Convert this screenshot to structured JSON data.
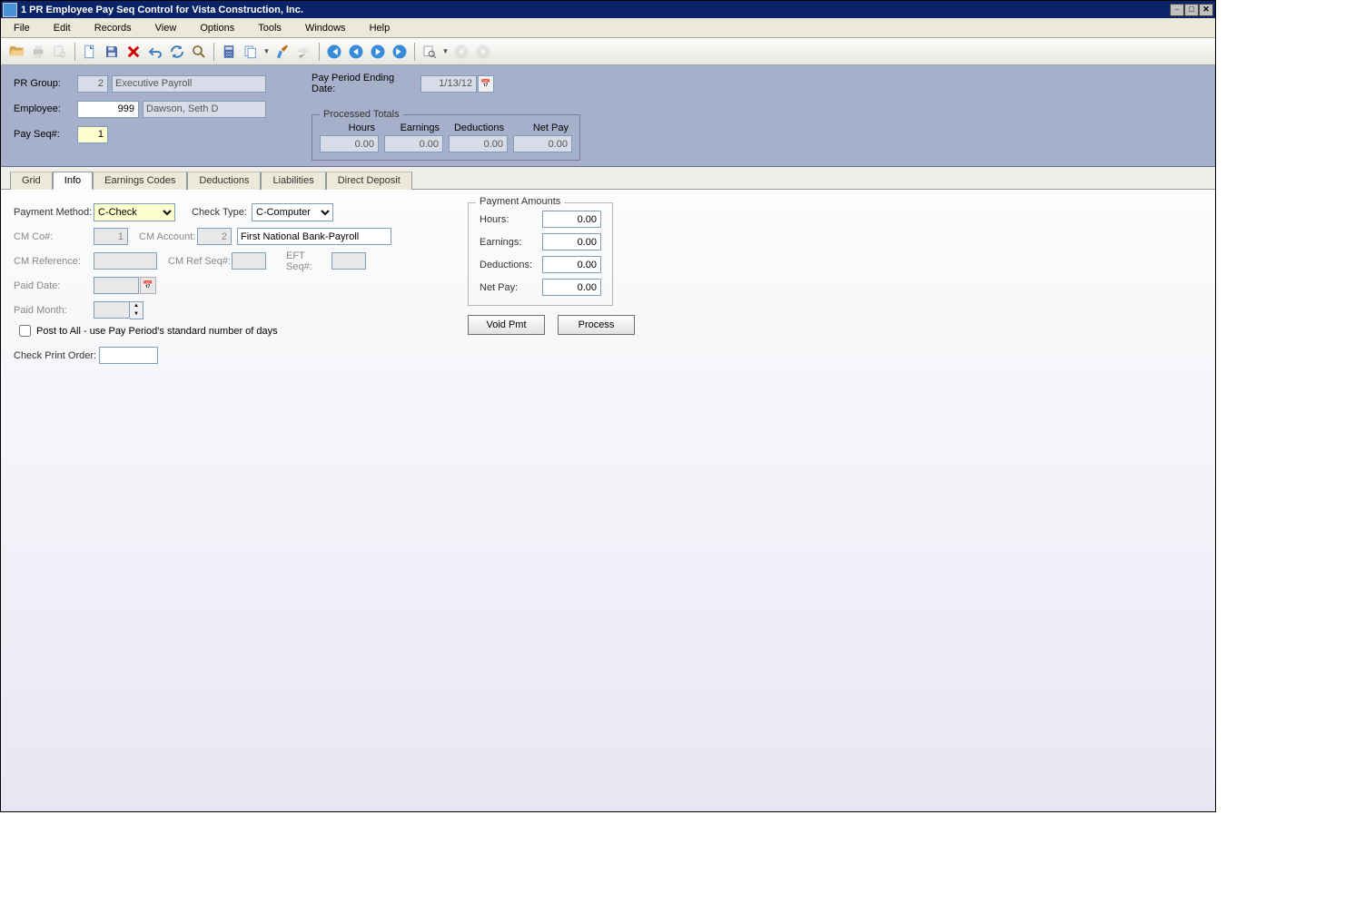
{
  "window": {
    "title": "1 PR Employee Pay Seq Control for Vista Construction, Inc."
  },
  "menu": {
    "file": "File",
    "edit": "Edit",
    "records": "Records",
    "view": "View",
    "options": "Options",
    "tools": "Tools",
    "windows": "Windows",
    "help": "Help"
  },
  "header": {
    "pr_group_label": "PR Group:",
    "pr_group": "2",
    "pr_group_desc": "Executive Payroll",
    "employee_label": "Employee:",
    "employee": "999",
    "employee_desc": "Dawson, Seth D",
    "pay_seq_label": "Pay Seq#:",
    "pay_seq": "1",
    "period_end_label": "Pay Period Ending Date:",
    "period_end": "1/13/12",
    "processed_totals_label": "Processed Totals",
    "col_hours": "Hours",
    "col_earnings": "Earnings",
    "col_deductions": "Deductions",
    "col_netpay": "Net Pay",
    "pt_hours": "0.00",
    "pt_earnings": "0.00",
    "pt_deductions": "0.00",
    "pt_netpay": "0.00"
  },
  "tabs": {
    "grid": "Grid",
    "info": "Info",
    "earnings": "Earnings Codes",
    "deductions": "Deductions",
    "liabilities": "Liabilities",
    "direct_deposit": "Direct Deposit"
  },
  "info": {
    "payment_method_label": "Payment Method:",
    "payment_method": "C-Check",
    "check_type_label": "Check Type:",
    "check_type": "C-Computer",
    "cm_co_label": "CM Co#:",
    "cm_co": "1",
    "cm_account_label": "CM Account:",
    "cm_account": "2",
    "cm_account_desc": "First National Bank-Payroll",
    "cm_ref_label": "CM Reference:",
    "cm_ref": "",
    "cm_ref_seq_label": "CM Ref Seq#:",
    "cm_ref_seq": "",
    "eft_seq_label": "EFT Seq#:",
    "eft_seq": "",
    "paid_date_label": "Paid Date:",
    "paid_date": "",
    "paid_month_label": "Paid Month:",
    "paid_month": "",
    "post_all_label": "Post to All - use Pay Period's standard number of days",
    "check_print_order_label": "Check Print Order:",
    "check_print_order": "",
    "pa_legend": "Payment Amounts",
    "pa_hours_label": "Hours:",
    "pa_hours": "0.00",
    "pa_earnings_label": "Earnings:",
    "pa_earnings": "0.00",
    "pa_deductions_label": "Deductions:",
    "pa_deductions": "0.00",
    "pa_netpay_label": "Net Pay:",
    "pa_netpay": "0.00",
    "void_pmt": "Void Pmt",
    "process": "Process"
  }
}
